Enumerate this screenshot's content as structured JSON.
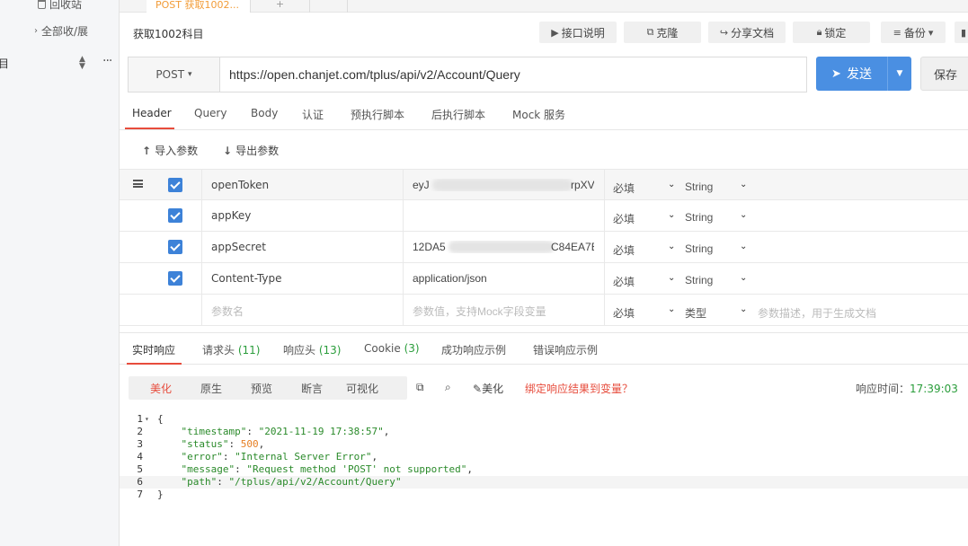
{
  "sidebar": {
    "recycle_label": "回收站",
    "collapse_label": "全部收/展",
    "item_label": "目"
  },
  "doc_tabs": {
    "active": "POST 获取1002..."
  },
  "toolbar": {
    "title": "获取1002科目",
    "doc_btn": "接口说明",
    "clone_btn": "克隆",
    "share_btn": "分享文档",
    "lock_btn": "锁定",
    "backup_btn": "备份"
  },
  "request": {
    "method": "POST",
    "url": "https://open.chanjet.com/tplus/api/v2/Account/Query",
    "send_label": "发送",
    "save_label": "保存"
  },
  "req_tabs": [
    "Header",
    "Query",
    "Body",
    "认证",
    "预执行脚本",
    "后执行脚本",
    "Mock 服务"
  ],
  "actions": {
    "import_label": "导入参数",
    "export_label": "导出参数"
  },
  "params": [
    {
      "name": "openToken",
      "value_start": "eyJ",
      "value_end": "rpXV(",
      "required": "必填",
      "type": "String"
    },
    {
      "name": "appKey",
      "value_start": "",
      "value_end": "",
      "required": "必填",
      "type": "String"
    },
    {
      "name": "appSecret",
      "value_start": "12DA5",
      "value_end": "C84EA7E",
      "required": "必填",
      "type": "String"
    },
    {
      "name": "Content-Type",
      "value_start": "application/json",
      "value_end": "",
      "required": "必填",
      "type": "String"
    }
  ],
  "new_param": {
    "name_placeholder": "参数名",
    "value_placeholder": "参数值，支持Mock字段变量",
    "required": "必填",
    "type": "类型",
    "desc_placeholder": "参数描述，用于生成文档"
  },
  "resp_tabs": [
    {
      "label": "实时响应",
      "count": ""
    },
    {
      "label": "请求头",
      "count": "(11)"
    },
    {
      "label": "响应头",
      "count": "(13)"
    },
    {
      "label": "Cookie",
      "count": "(3)"
    },
    {
      "label": "成功响应示例",
      "count": ""
    },
    {
      "label": "错误响应示例",
      "count": ""
    }
  ],
  "view_tabs": [
    "美化",
    "原生",
    "预览",
    "断言",
    "可视化"
  ],
  "tools": {
    "beautify_label": "美化",
    "bind_label": "绑定响应结果到变量？",
    "resp_time_label": "响应时间：",
    "resp_time_value": "17:39:03"
  },
  "response": {
    "timestamp": "2021-11-19 17:38:57",
    "status": 500,
    "error": "Internal Server Error",
    "message": "Request method 'POST' not supported",
    "path": "/tplus/api/v2/Account/Query"
  },
  "colors": {
    "accent": "#e74c3c",
    "primary": "#4a8fe2",
    "success": "#2a9d3b",
    "number": "#e67e22"
  }
}
